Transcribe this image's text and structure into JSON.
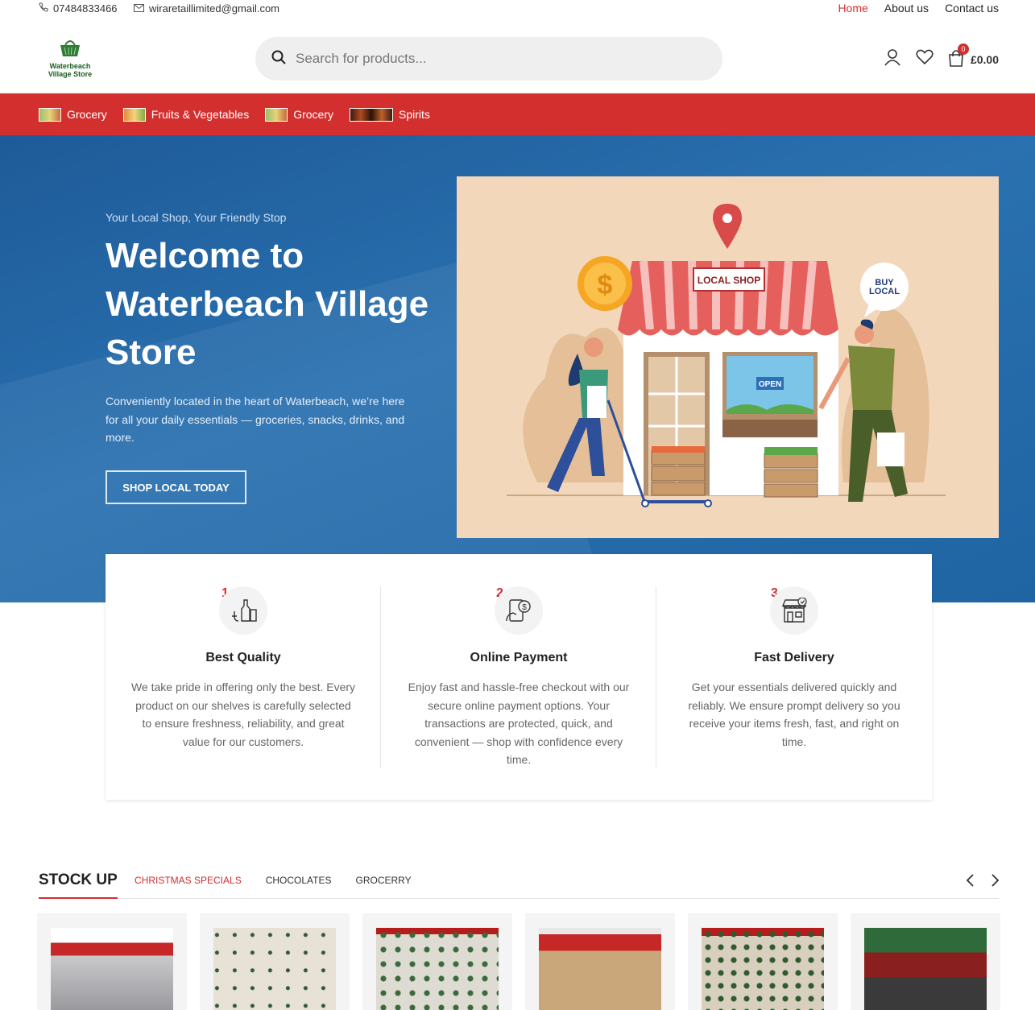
{
  "topbar": {
    "phone": "07484833466",
    "email": "wiraretaillimited@gmail.com",
    "nav": [
      {
        "label": "Home",
        "active": true
      },
      {
        "label": "About us",
        "active": false
      },
      {
        "label": "Contact us",
        "active": false
      }
    ]
  },
  "header": {
    "logo_line1": "Waterbeach",
    "logo_line2": "Village Store",
    "search_placeholder": "Search for products...",
    "cart_count": "0",
    "cart_total": "£0.00"
  },
  "categories": [
    {
      "label": "Grocery",
      "color": "#9bbf6a"
    },
    {
      "label": "Fruits & Vegetables",
      "color": "#e08a3c"
    },
    {
      "label": "Grocery",
      "color": "#9bbf6a"
    },
    {
      "label": "Spirits",
      "color": "#5a2a1a"
    }
  ],
  "hero": {
    "subtitle": "Your Local Shop, Your Friendly Stop",
    "title": "Welcome to Waterbeach Village Store",
    "description": "Conveniently located in the heart of Waterbeach, we’re here for all your daily essentials — groceries, snacks, drinks, and more.",
    "button": "SHOP LOCAL TODAY",
    "illus_sign": "LOCAL SHOP",
    "illus_bubble_1": "BUY",
    "illus_bubble_2": "LOCAL",
    "illus_open": "OPEN"
  },
  "features": [
    {
      "num": "1.",
      "title": "Best Quality",
      "icon": "bottles-icon",
      "text": "We take pride in offering only the best. Every product on our shelves is carefully selected to ensure freshness, reliability, and great value for our customers."
    },
    {
      "num": "2.",
      "title": "Online Payment",
      "icon": "mobile-payment-icon",
      "text": "Enjoy fast and hassle-free checkout with our secure online payment options. Your transactions are protected, quick, and convenient — shop with confidence every time."
    },
    {
      "num": "3.",
      "title": "Fast Delivery",
      "icon": "storefront-icon",
      "text": "Get your essentials delivered quickly and reliably. We ensure prompt delivery so you receive your items fresh, fast, and right on time."
    }
  ],
  "stock": {
    "title": "STOCK UP",
    "tabs": [
      {
        "label": "CHRISTMAS SPECIALS",
        "active": true
      },
      {
        "label": "CHOCOLATES",
        "active": false
      },
      {
        "label": "GROCERRY",
        "active": false
      }
    ]
  },
  "products": [
    {
      "color": "#c9c9cc"
    },
    {
      "color": "#e8e2d6"
    },
    {
      "color": "#dedbd2"
    },
    {
      "color": "#c9a77a"
    },
    {
      "color": "#d9cfbf"
    },
    {
      "color": "#6a7a5a"
    }
  ],
  "colors": {
    "accent": "#d32f2f",
    "hero_blue": "#1f64a3"
  }
}
